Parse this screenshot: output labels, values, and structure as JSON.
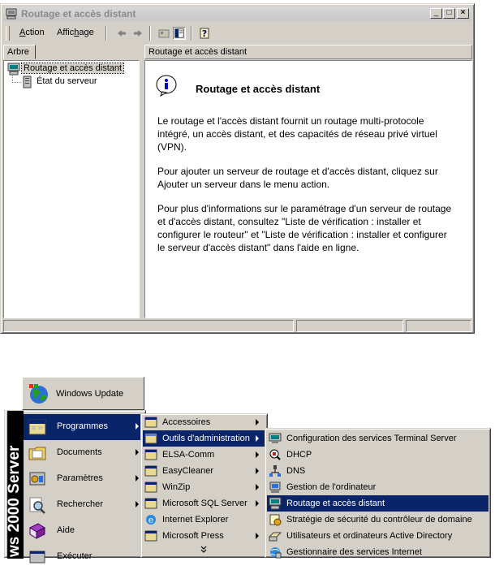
{
  "window": {
    "title": "Routage et accès distant",
    "menu": {
      "action": "Action",
      "view": "Affichage"
    },
    "left_tab": "Arbre",
    "right_header": "Routage et accès distant",
    "tree": [
      {
        "label": "Routage et accès distant",
        "icon": "server-computer-icon",
        "selected": true
      },
      {
        "label": "État du serveur",
        "icon": "server-status-icon"
      }
    ],
    "content": {
      "heading": "Routage et accès distant",
      "paragraphs": [
        "Le routage et l'accès distant fournit un routage multi-protocole intégré, un accès distant, et des capacités de réseau privé virtuel (VPN).",
        "Pour ajouter un serveur de routage et d'accès distant, cliquez sur Ajouter un serveur dans le menu action.",
        "Pour plus d'informations sur le paramétrage d'un serveur de routage et d'accès distant, consultez \"Liste de vérification : installer et configurer le routeur\" et \"Liste de vérification : installer et configurer le serveur d'accès distant\" dans l'aide en ligne."
      ]
    }
  },
  "start_menu": {
    "band": "ws 2000 Server",
    "top_item": "Windows Update",
    "items": [
      {
        "label": "Programmes",
        "highlighted": true,
        "submenu": true
      },
      {
        "label": "Documents",
        "submenu": true
      },
      {
        "label": "Paramètres",
        "submenu": true
      },
      {
        "label": "Rechercher",
        "submenu": true
      },
      {
        "label": "Aide"
      },
      {
        "label": "Exécuter"
      }
    ]
  },
  "programs_menu": [
    {
      "label": "Accessoires",
      "submenu": true
    },
    {
      "label": "Outils d'administration",
      "submenu": true,
      "highlighted": true
    },
    {
      "label": "ELSA-Comm",
      "submenu": true
    },
    {
      "label": "EasyCleaner",
      "submenu": true
    },
    {
      "label": "WinZip",
      "submenu": true
    },
    {
      "label": "Microsoft SQL Server",
      "submenu": true
    },
    {
      "label": "Internet Explorer"
    },
    {
      "label": "Microsoft Press",
      "submenu": true
    }
  ],
  "admin_tools_menu": [
    {
      "label": "Configuration des services Terminal Server"
    },
    {
      "label": "DHCP"
    },
    {
      "label": "DNS"
    },
    {
      "label": "Gestion de l'ordinateur"
    },
    {
      "label": "Routage et accès distant",
      "highlighted": true
    },
    {
      "label": "Stratégie de sécurité du contrôleur de domaine"
    },
    {
      "label": "Utilisateurs et ordinateurs Active Directory"
    },
    {
      "label": "Gestionnaire des services Internet"
    }
  ],
  "colors": {
    "highlight": "#0a246a",
    "face": "#d4d0c8"
  }
}
